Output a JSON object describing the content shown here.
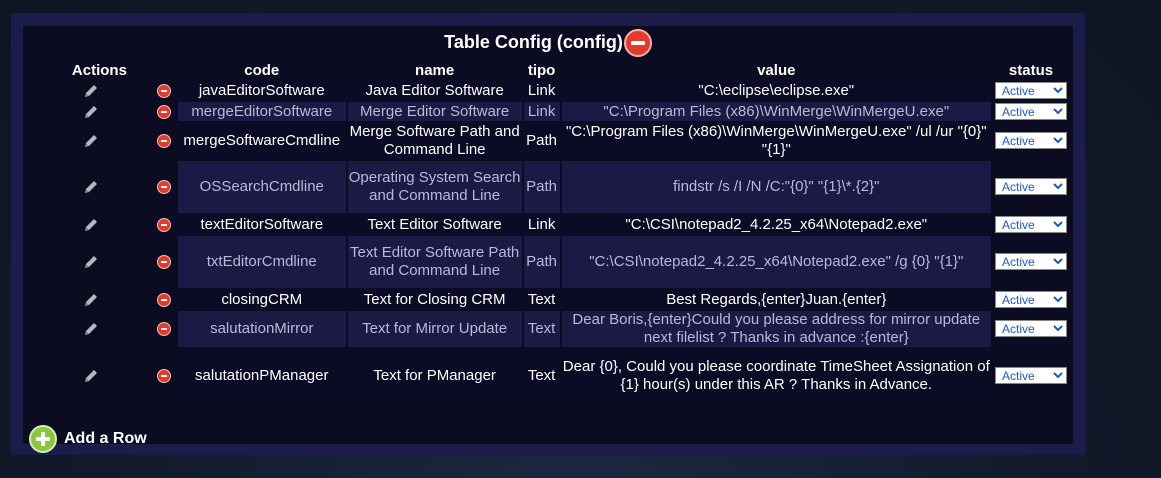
{
  "title": "Table Config (config)",
  "columns": {
    "actions": "Actions",
    "code": "code",
    "name": "name",
    "tipo": "tipo",
    "value": "value",
    "status": "status"
  },
  "rows": [
    {
      "code": "javaEditorSoftware",
      "name": "Java Editor Software",
      "tipo": "Link",
      "value": "\"C:\\eclipse\\eclipse.exe\"",
      "status": "Active"
    },
    {
      "code": "mergeEditorSoftware",
      "name": "Merge Editor Software",
      "tipo": "Link",
      "value": "\"C:\\Program Files (x86)\\WinMerge\\WinMergeU.exe\"",
      "status": "Active"
    },
    {
      "code": "mergeSoftwareCmdline",
      "name": "Merge Software Path and Command Line",
      "tipo": "Path",
      "value": "\"C:\\Program Files (x86)\\WinMerge\\WinMergeU.exe\" /ul /ur \"{0}\" \"{1}\"",
      "status": "Active"
    },
    {
      "code": "OSSearchCmdline",
      "name": "Operating System Search and Command Line",
      "tipo": "Path",
      "value": "findstr /s /I /N /C:\"{0}\" \"{1}\\*.{2}\"",
      "status": "Active"
    },
    {
      "code": "textEditorSoftware",
      "name": "Text Editor Software",
      "tipo": "Link",
      "value": "\"C:\\CSI\\notepad2_4.2.25_x64\\Notepad2.exe\"",
      "status": "Active"
    },
    {
      "code": "txtEditorCmdline",
      "name": "Text Editor Software Path and Command Line",
      "tipo": "Path",
      "value": "\"C:\\CSI\\notepad2_4.2.25_x64\\Notepad2.exe\" /g {0} \"{1}\"",
      "status": "Active"
    },
    {
      "code": "closingCRM",
      "name": "Text for Closing CRM",
      "tipo": "Text",
      "value": "Best Regards,{enter}Juan.{enter}",
      "status": "Active"
    },
    {
      "code": "salutationMirror",
      "name": "Text for Mirror Update",
      "tipo": "Text",
      "value": "Dear Boris,{enter}Could you please address for mirror update next filelist ? Thanks in advance :{enter}",
      "status": "Active"
    },
    {
      "code": "salutationPManager",
      "name": "Text for PManager",
      "tipo": "Text",
      "value": "Dear {0}, Could you please coordinate TimeSheet Assignation of {1} hour(s) under this AR ? Thanks in Advance.",
      "status": "Active"
    }
  ],
  "add_row_label": "Add a Row",
  "icons": {
    "edit": "pencil-icon",
    "delete": "remove-icon",
    "add": "plus-icon"
  },
  "colors": {
    "delete": "#e23b2e",
    "add": "#8cc63f",
    "panel": "#1c1c4a"
  }
}
